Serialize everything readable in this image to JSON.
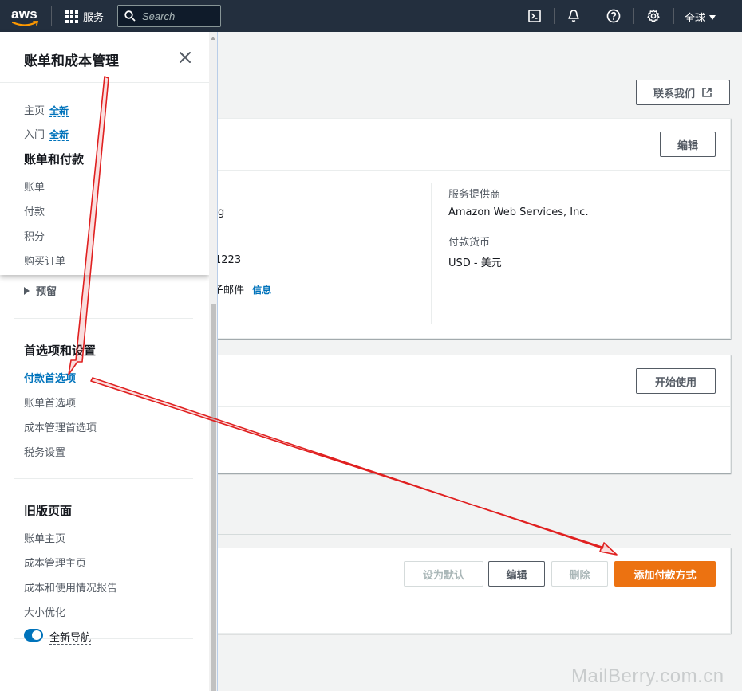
{
  "topnav": {
    "logo_text": "aws",
    "services_label": "服务",
    "search_placeholder": "Search",
    "region_label": "全球"
  },
  "main": {
    "contact_button": "联系我们",
    "account_panel": {
      "edit_button": "编辑",
      "partial_value_1": "g",
      "partial_value_2": "1223",
      "partial_email_label": "子邮件",
      "info_link": "信息",
      "provider_label": "服务提供商",
      "provider_value": "Amazon Web Services, Inc.",
      "currency_label": "付款货币",
      "currency_value": "USD - 美元"
    },
    "second_panel": {
      "start_button": "开始使用"
    },
    "payment_panel": {
      "set_default_button": "设为默认",
      "edit_button": "编辑",
      "delete_button": "删除",
      "add_payment_button": "添加付款方式"
    }
  },
  "sidepanel": {
    "title": "账单和成本管理",
    "items": [
      {
        "label": "主页",
        "badge": "全新"
      },
      {
        "label": "入门",
        "badge": "全新"
      }
    ],
    "section_billing": "账单和付款",
    "billing_items": [
      "账单",
      "付款",
      "积分",
      "购买订单"
    ],
    "reservations": "预留",
    "section_preferences": "首选项和设置",
    "preferences_items": [
      "付款首选项",
      "账单首选项",
      "成本管理首选项",
      "税务设置"
    ],
    "section_legacy": "旧版页面",
    "legacy_items": [
      "账单主页",
      "成本管理主页",
      "成本和使用情况报告",
      "大小优化"
    ],
    "toggle_label": "全新导航"
  },
  "watermark": "MailBerry.com.cn",
  "colors": {
    "nav_bg": "#232f3e",
    "link": "#0073bb",
    "primary": "#ec7211",
    "annotation": "#e02020"
  }
}
